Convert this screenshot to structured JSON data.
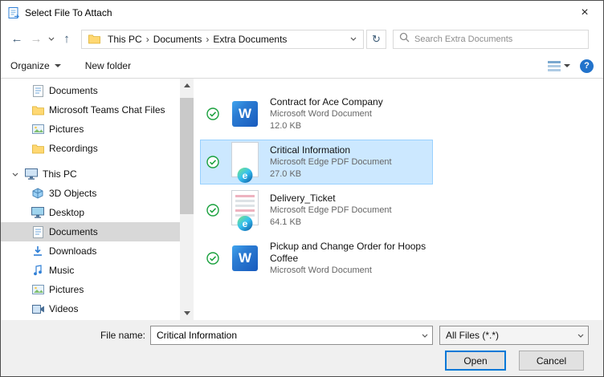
{
  "colors": {
    "accent": "#0078d7",
    "selection_fill": "#cce8ff",
    "selection_border": "#98d1ff",
    "sidebar_selected": "#d8d8d8",
    "sync_green": "#18a03c",
    "word_blue": "#185abd",
    "folder_yellow": "#ffd873"
  },
  "window": {
    "title": "Select File To Attach",
    "close_glyph": "×"
  },
  "nav": {
    "back_glyph": "←",
    "forward_glyph": "→",
    "up_glyph": "↑",
    "refresh_glyph": "↻",
    "crumbs": [
      "This PC",
      "Documents",
      "Extra Documents"
    ],
    "crumb_sep": "›",
    "search": {
      "placeholder": "Search Extra Documents"
    }
  },
  "toolbar": {
    "organize_label": "Organize",
    "new_folder_label": "New folder",
    "help_glyph": "?"
  },
  "sidebar": {
    "items": [
      {
        "label": "Documents",
        "icon": "documents-folder"
      },
      {
        "label": "Microsoft Teams Chat Files",
        "icon": "folder"
      },
      {
        "label": "Pictures",
        "icon": "pictures-folder"
      },
      {
        "label": "Recordings",
        "icon": "folder"
      },
      {
        "label": "This PC",
        "icon": "computer",
        "expanded": true
      },
      {
        "label": "3D Objects",
        "icon": "3d-objects"
      },
      {
        "label": "Desktop",
        "icon": "desktop"
      },
      {
        "label": "Documents",
        "icon": "documents",
        "selected": true
      },
      {
        "label": "Downloads",
        "icon": "downloads"
      },
      {
        "label": "Music",
        "icon": "music"
      },
      {
        "label": "Pictures",
        "icon": "pictures"
      },
      {
        "label": "Videos",
        "icon": "videos"
      }
    ]
  },
  "files": [
    {
      "name": "Contract for Ace Company",
      "type": "Microsoft Word Document",
      "size": "12.0 KB",
      "icon": "word",
      "selected": false
    },
    {
      "name": "Critical Information",
      "type": "Microsoft Edge PDF Document",
      "size": "27.0 KB",
      "icon": "edge-pdf",
      "selected": true
    },
    {
      "name": "Delivery_Ticket",
      "type": "Microsoft Edge PDF Document",
      "size": "64.1 KB",
      "icon": "edge-pdf",
      "selected": false
    },
    {
      "name": "Pickup and Change Order for Hoops Coffee",
      "type": "Microsoft Word Document",
      "size": "",
      "icon": "word",
      "selected": false
    }
  ],
  "file_icons": {
    "word_glyph": "W",
    "edge_glyph": "e"
  },
  "footer": {
    "file_name_label": "File name:",
    "file_name_value": "Critical Information",
    "file_type_value": "All Files (*.*)",
    "open_label": "Open",
    "cancel_label": "Cancel"
  }
}
